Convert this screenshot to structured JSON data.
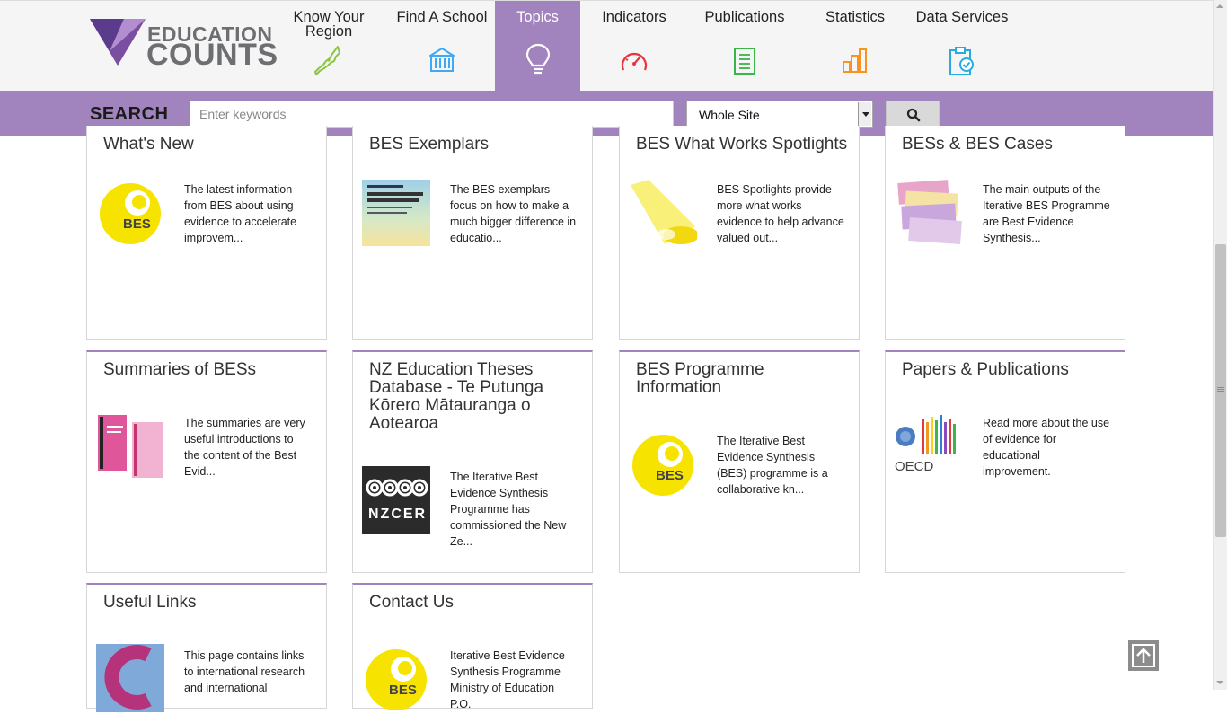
{
  "logo": {
    "line1": "EDUCATION",
    "line2": "COUNTS"
  },
  "nav": [
    {
      "label": "Know Your Region",
      "icon": "nz-map-icon",
      "color": "#8cc63f",
      "active": false
    },
    {
      "label": "Find A School",
      "icon": "school-building-icon",
      "color": "#3fa9f5",
      "active": false
    },
    {
      "label": "Topics",
      "icon": "lightbulb-icon",
      "color": "#ffffff",
      "active": true
    },
    {
      "label": "Indicators",
      "icon": "gauge-icon",
      "color": "#e8343a",
      "active": false
    },
    {
      "label": "Publications",
      "icon": "document-icon",
      "color": "#39b54a",
      "active": false
    },
    {
      "label": "Statistics",
      "icon": "bar-chart-icon",
      "color": "#f7931e",
      "active": false
    },
    {
      "label": "Data Services",
      "icon": "clipboard-check-icon",
      "color": "#29abe2",
      "active": false
    }
  ],
  "search": {
    "title": "SEARCH",
    "placeholder": "Enter keywords",
    "scope": "Whole Site",
    "button_icon": "search-icon"
  },
  "cards": [
    {
      "title": "What's New",
      "desc": "The latest information from BES about using evidence to accelerate improvem...",
      "thumb": "bes-logo"
    },
    {
      "title": "BES Exemplars",
      "desc": "The BES exemplars focus on how to make a much bigger difference in educatio...",
      "thumb": "exemplar-cover"
    },
    {
      "title": "BES What Works Spotlights",
      "desc": "BES Spotlights provide more what works evidence to help advance valued out...",
      "thumb": "spotlight"
    },
    {
      "title": "BESs & BES Cases",
      "desc": "The main outputs of the Iterative BES Programme are Best Evidence Synthesis...",
      "thumb": "bes-cases"
    },
    {
      "title": "Summaries of BESs",
      "desc": "The summaries are very useful introductions to the content of the Best Evid...",
      "thumb": "summaries"
    },
    {
      "title": "NZ Education Theses Database - Te Putunga Kōrero Mātauranga o Aotearoa",
      "desc": "The Iterative Best Evidence Synthesis Programme has commissioned the New Ze...",
      "thumb": "nzcer",
      "thumb_text": "NZCER"
    },
    {
      "title": "BES Programme Information",
      "desc": "The Iterative Best Evidence Synthesis (BES) programme is a collaborative kn...",
      "thumb": "bes-logo"
    },
    {
      "title": "Papers & Publications",
      "desc": "Read more about the use of evidence for educational improvement.",
      "thumb": "oecd",
      "thumb_text": "OECD"
    },
    {
      "title": "Useful Links",
      "desc": "This page contains links to international research and international",
      "thumb": "links"
    },
    {
      "title": "Contact Us",
      "desc": "Iterative Best Evidence Synthesis Programme Ministry of Education P.O.",
      "thumb": "bes-logo"
    }
  ],
  "bes_logo_text": "BES",
  "back_to_top_icon": "arrow-up-icon",
  "colors": {
    "accent": "#a183be",
    "bes_yellow": "#f6e400"
  }
}
